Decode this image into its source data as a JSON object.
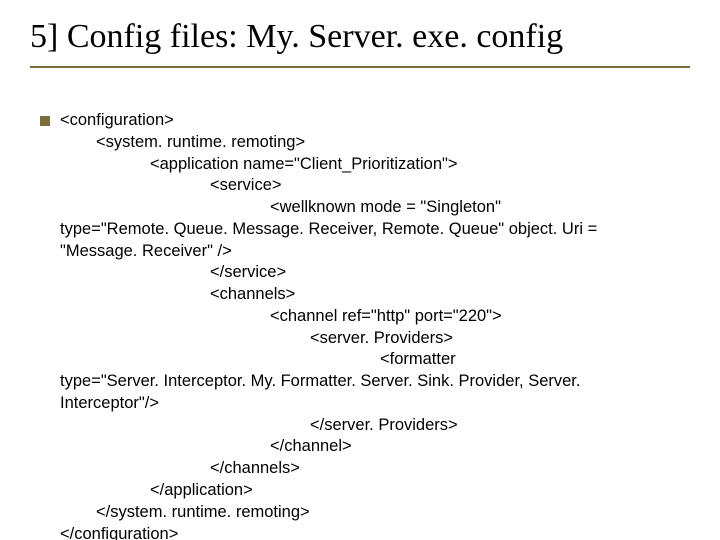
{
  "title": "5] Config files: My. Server. exe. config",
  "code": {
    "l01": "<configuration>",
    "l02": "<system. runtime. remoting>",
    "l03": "<application name=\"Client_Prioritization\">",
    "l04": "<service>",
    "l05": "<wellknown mode = \"Singleton\"",
    "l05b": "type=\"Remote. Queue. Message. Receiver, Remote. Queue\" object. Uri = \"Message. Receiver\" />",
    "l06": "</service>",
    "l07": "<channels>",
    "l08": "<channel ref=\"http\" port=\"220\">",
    "l09": "<server. Providers>",
    "l10": "<formatter",
    "l10b": "type=\"Server. Interceptor. My. Formatter. Server. Sink. Provider, Server. Interceptor\"/>",
    "l11": "</server. Providers>",
    "l12": "</channel>",
    "l13": "</channels>",
    "l14": "</application>",
    "l15": "</system. runtime. remoting>",
    "l16": "</configuration>"
  }
}
